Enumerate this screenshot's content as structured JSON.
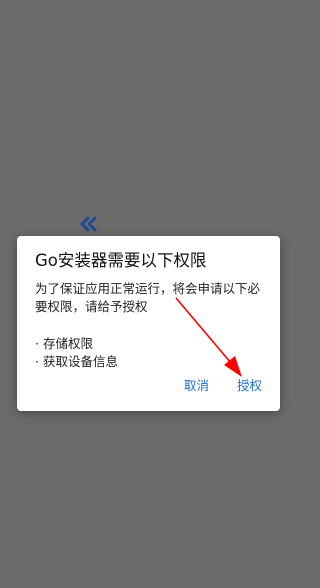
{
  "dialog": {
    "title": "Go安装器需要以下权限",
    "message": "为了保证应用正常运行，将会申请以下必要权限，请给予授权",
    "permissions": [
      "· 存储权限",
      "· 获取设备信息"
    ],
    "cancel_label": "取消",
    "grant_label": "授权"
  },
  "colors": {
    "overlay": "#6b6b6b",
    "accent": "#1f6fd0",
    "annotation": "#ff0000"
  },
  "icons": {
    "background_chevron": "double-chevron-left-icon",
    "annotation": "red-arrow-icon"
  }
}
